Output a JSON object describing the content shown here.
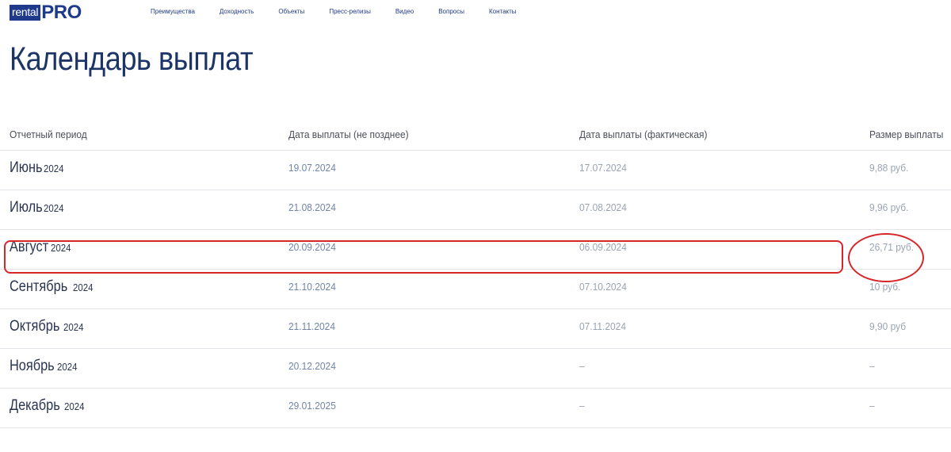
{
  "header": {
    "logo_rental": "rental",
    "logo_pro": "PRO",
    "nav": [
      "Преимущества",
      "Доходность",
      "Объекты",
      "Пресс-релизы",
      "Видео",
      "Вопросы",
      "Контакты"
    ]
  },
  "page_title": "Календарь выплат",
  "table": {
    "columns": [
      "Отчетный период",
      "Дата выплаты (не позднее)",
      "Дата выплаты (фактическая)",
      "Размер выплаты"
    ],
    "rows": [
      {
        "month": "Июнь",
        "year": "2024",
        "due": "19.07.2024",
        "actual": "17.07.2024",
        "amount": "9,88 руб."
      },
      {
        "month": "Июль",
        "year": "2024",
        "due": "21.08.2024",
        "actual": "07.08.2024",
        "amount": "9,96 руб."
      },
      {
        "month": "Август",
        "year": "2024",
        "due": "20.09.2024",
        "actual": "06.09.2024",
        "amount": "26,71 руб."
      },
      {
        "month": "Сентябрь",
        "year": "2024",
        "due": "21.10.2024",
        "actual": "07.10.2024",
        "amount": "10 руб."
      },
      {
        "month": "Октябрь",
        "year": "2024",
        "due": "21.11.2024",
        "actual": "07.11.2024",
        "amount": "9,90 руб"
      },
      {
        "month": "Ноябрь",
        "year": "2024",
        "due": "20.12.2024",
        "actual": "–",
        "amount": "–"
      },
      {
        "month": "Декабрь",
        "year": "2024",
        "due": "29.01.2025",
        "actual": "–",
        "amount": "–"
      }
    ]
  },
  "annotation_color": "#d6262a",
  "brand_color": "#1f3a8a"
}
